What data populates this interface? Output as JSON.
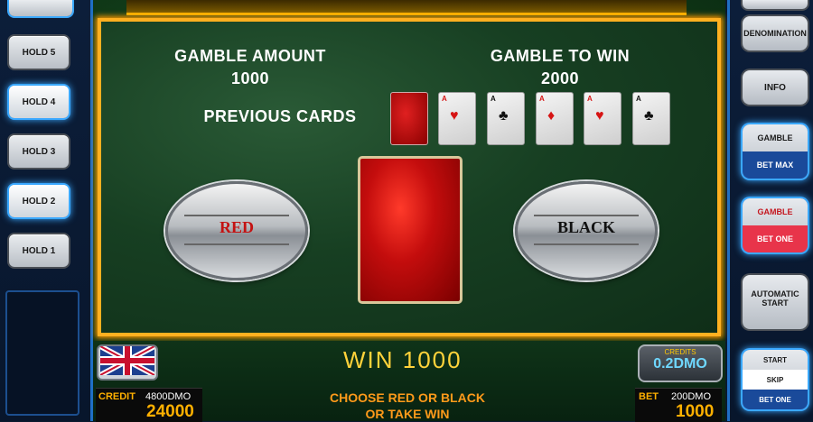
{
  "left_panel": {
    "holds": [
      "HOLD 5",
      "HOLD 4",
      "HOLD 3",
      "HOLD 2",
      "HOLD 1"
    ]
  },
  "right_panel": {
    "denomination": "DENOMINATION",
    "info": "INFO",
    "gamble_top": "GAMBLE",
    "bet_max": "BET MAX",
    "gamble_top2": "GAMBLE",
    "bet_one": "BET ONE",
    "automatic": "AUTOMATIC",
    "start": "START",
    "start2": "START",
    "skip": "SKIP",
    "bet_one2": "BET ONE"
  },
  "gamble": {
    "amount_label": "GAMBLE AMOUNT",
    "amount_value": "1000",
    "to_win_label": "GAMBLE TO WIN",
    "to_win_value": "2000",
    "previous_label": "PREVIOUS CARDS",
    "red_label": "RED",
    "black_label": "BLACK",
    "previous_cards": [
      {
        "rank": "",
        "suit": "back"
      },
      {
        "rank": "A",
        "suit": "♥"
      },
      {
        "rank": "A",
        "suit": "♣"
      },
      {
        "rank": "A",
        "suit": "♦"
      },
      {
        "rank": "A",
        "suit": "♥"
      },
      {
        "rank": "A",
        "suit": "♣"
      }
    ]
  },
  "bottom": {
    "win_text": "WIN 1000",
    "credit_box_label": "CREDITS",
    "credit_box_value": "0.2DMO",
    "message_line1": "CHOOSE RED OR BLACK",
    "message_line2": "OR TAKE WIN",
    "credit_label": "CREDIT",
    "credit_dmo": "4800DMO",
    "credit_value": "24000",
    "bet_label": "BET",
    "bet_dmo": "200DMO",
    "bet_value": "1000"
  },
  "colors": {
    "frame_gold": "#ffb020",
    "win_yellow": "#ffd23a",
    "message_orange": "#ff9a1a",
    "accent_blue": "#3aa8ff"
  }
}
